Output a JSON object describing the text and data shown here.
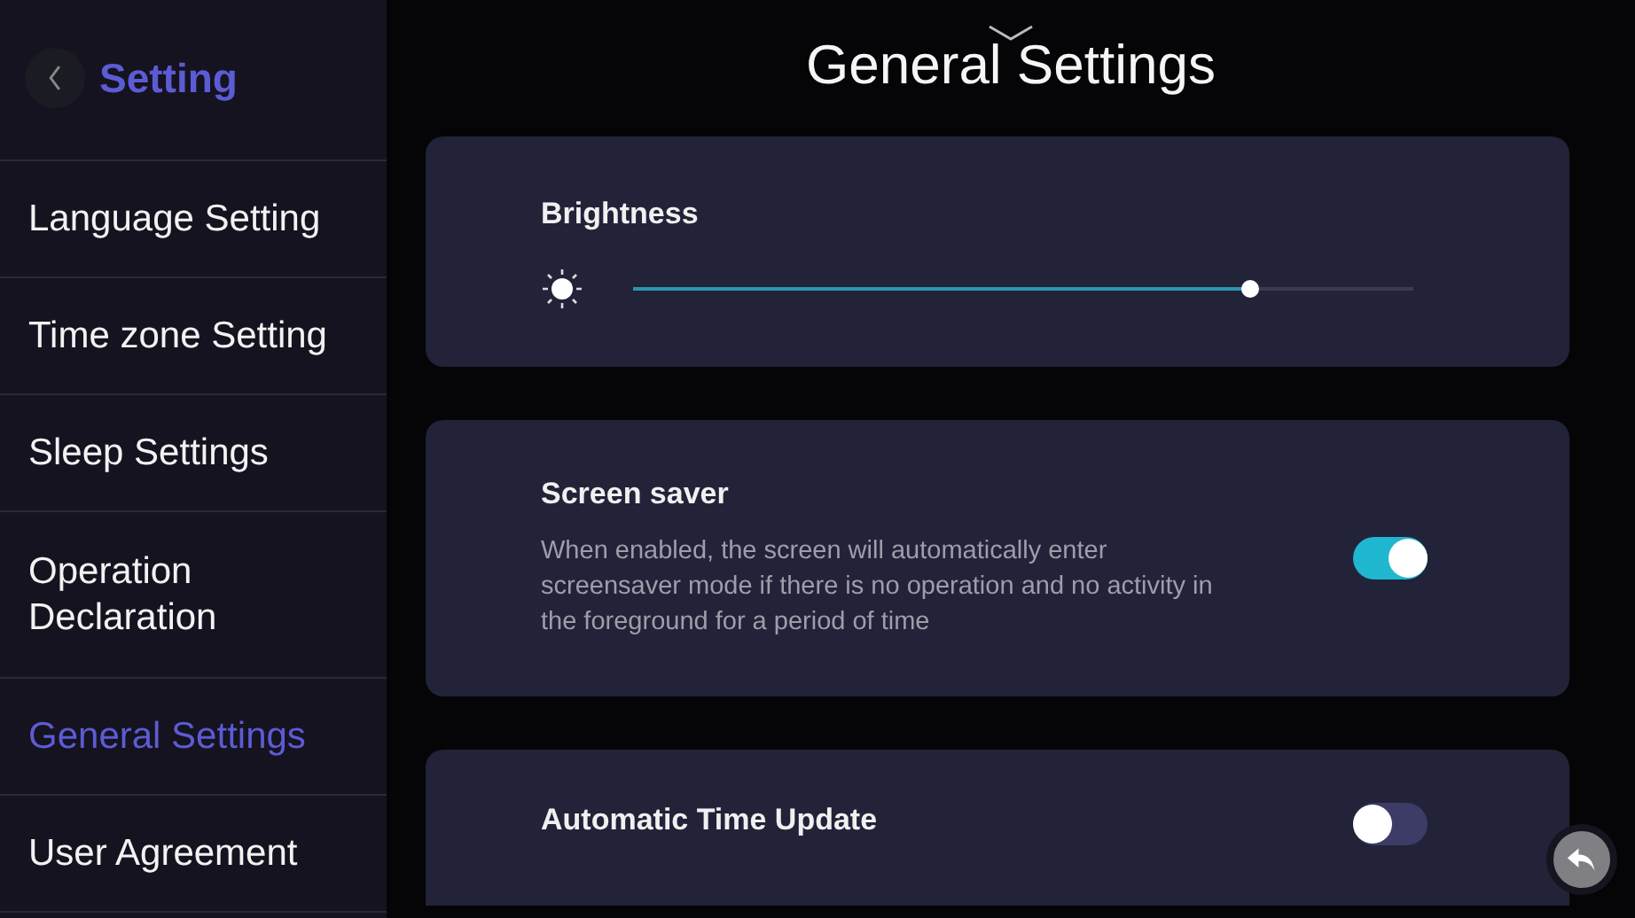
{
  "sidebar": {
    "title": "Setting",
    "items": [
      {
        "label": "Language Setting",
        "selected": false
      },
      {
        "label": "Time zone Setting",
        "selected": false
      },
      {
        "label": "Sleep Settings",
        "selected": false
      },
      {
        "label": "Operation Declaration",
        "selected": false
      },
      {
        "label": "General Settings",
        "selected": true
      },
      {
        "label": "User Agreement",
        "selected": false
      }
    ]
  },
  "page_title": "General Settings",
  "cards": [
    {
      "kind": "slider",
      "title": "Brightness",
      "level": 0.79
    },
    {
      "kind": "toggle",
      "title": "Screen saver",
      "description": "When enabled, the screen will automatically enter screensaver mode if there is no operation and no activity in the foreground for a period of time",
      "on": true
    },
    {
      "kind": "toggle",
      "title": "Automatic Time Update",
      "on": false
    }
  ]
}
